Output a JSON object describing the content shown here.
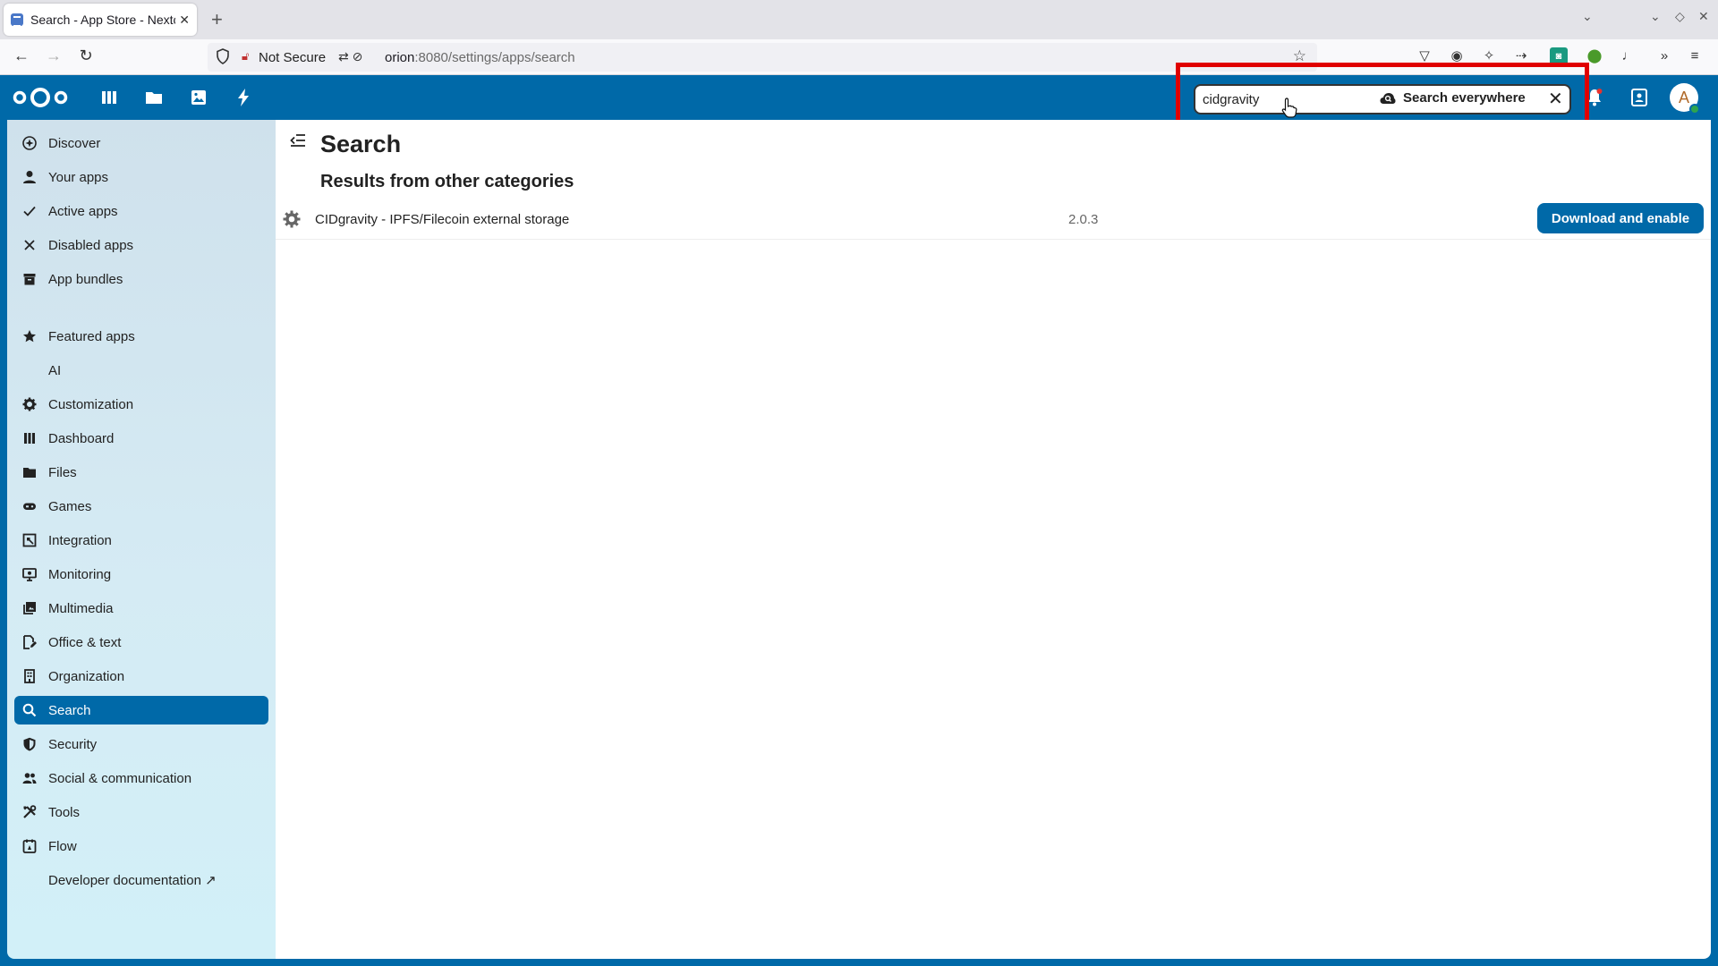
{
  "browser": {
    "tab_title": "Search - App Store - Nextcl",
    "tab_close": "✕",
    "new_tab": "+",
    "security_label": "Not Secure",
    "url_host": "orion",
    "url_rest": ":8080/settings/apps/search"
  },
  "search": {
    "value": "cidgravity",
    "everywhere_label": "Search everywhere",
    "clear": "✕"
  },
  "user": {
    "avatar_letter": "A"
  },
  "sidebar": {
    "items": [
      {
        "label": "Discover",
        "icon": "discover-icon"
      },
      {
        "label": "Your apps",
        "icon": "user-icon"
      },
      {
        "label": "Active apps",
        "icon": "check-icon"
      },
      {
        "label": "Disabled apps",
        "icon": "close-icon"
      },
      {
        "label": "App bundles",
        "icon": "archive-icon"
      },
      {
        "label": "Featured apps",
        "icon": "star-icon"
      },
      {
        "label": "AI",
        "icon": ""
      },
      {
        "label": "Customization",
        "icon": "cog-icon"
      },
      {
        "label": "Dashboard",
        "icon": "dashboard-icon"
      },
      {
        "label": "Files",
        "icon": "folder-icon"
      },
      {
        "label": "Games",
        "icon": "gamepad-icon"
      },
      {
        "label": "Integration",
        "icon": "integration-icon"
      },
      {
        "label": "Monitoring",
        "icon": "monitor-icon"
      },
      {
        "label": "Multimedia",
        "icon": "multimedia-icon"
      },
      {
        "label": "Office & text",
        "icon": "document-edit-icon"
      },
      {
        "label": "Organization",
        "icon": "organization-icon"
      },
      {
        "label": "Search",
        "icon": "search-icon"
      },
      {
        "label": "Security",
        "icon": "shield-icon"
      },
      {
        "label": "Social & communication",
        "icon": "people-icon"
      },
      {
        "label": "Tools",
        "icon": "tools-icon"
      },
      {
        "label": "Flow",
        "icon": "flow-icon"
      },
      {
        "label": "Developer documentation ↗",
        "icon": ""
      }
    ],
    "active": "Search"
  },
  "main": {
    "title": "Search",
    "section_title": "Results from other categories",
    "results": [
      {
        "name": "CIDgravity - IPFS/Filecoin external storage",
        "version": "2.0.3",
        "action": "Download and enable"
      }
    ]
  },
  "colors": {
    "primary": "#0069a8",
    "highlight": "#e00000"
  }
}
